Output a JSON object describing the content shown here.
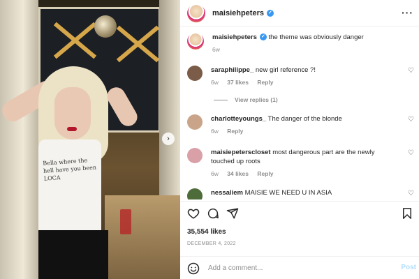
{
  "post": {
    "author": "maisiehpeters",
    "caption": "the theme was obviously danger",
    "caption_age": "6w",
    "shirt_text": "Bella where the hell have you been LOCA",
    "likes": "35,554 likes",
    "date": "DECEMBER 4, 2022"
  },
  "comments": [
    {
      "user": "saraphilippe_",
      "text": "new girl reference ?!",
      "age": "6w",
      "likes": "37 likes",
      "reply": "Reply",
      "avatar_color": "#7a5c48"
    },
    {
      "user": "charlotteyoungs_",
      "text": "The danger of the blonde",
      "age": "6w",
      "reply": "Reply",
      "avatar_color": "#c9a489"
    },
    {
      "user": "maisiepeterscloset",
      "text": "most dangerous part are the newly touched up roots",
      "age": "6w",
      "likes": "34 likes",
      "reply": "Reply",
      "avatar_color": "#d9a0a8"
    },
    {
      "user": "nessaliem",
      "text": "MAISIE WE NEED U IN ASIA",
      "avatar_color": "#4e6b3a"
    }
  ],
  "view_replies": "View replies (1)",
  "add_comment": {
    "placeholder": "Add a comment...",
    "post_label": "Post"
  },
  "icons": {
    "more": "more-options-icon",
    "like": "heart-icon",
    "comment": "comment-icon",
    "share": "share-icon",
    "save": "bookmark-icon",
    "emoji": "emoji-icon",
    "next": "chevron-right-icon"
  },
  "colors": {
    "verified": "#3897f0",
    "secondary_text": "#8e8e8e",
    "post_button": "#b2dffc"
  }
}
